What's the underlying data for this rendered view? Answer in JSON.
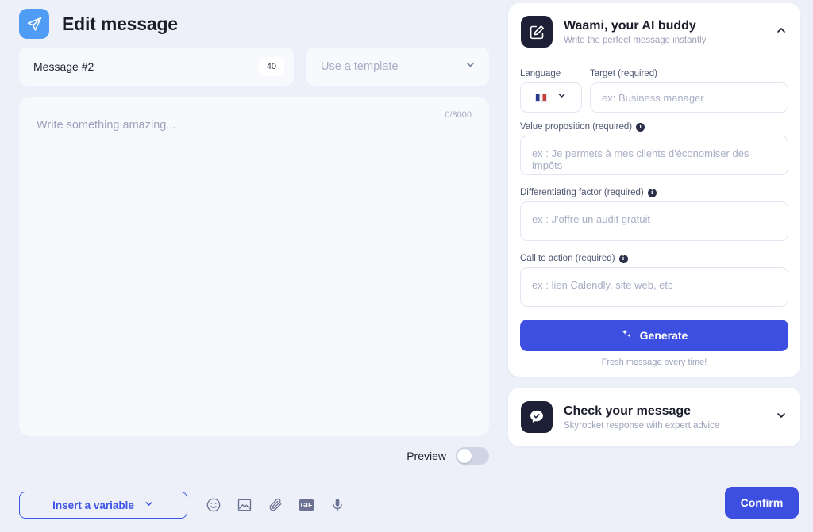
{
  "header": {
    "title": "Edit message",
    "logo_icon": "paper-plane-icon"
  },
  "message_bar": {
    "name": "Message #2",
    "char_badge": "40",
    "template_placeholder": "Use a template",
    "template_chevron": "chevron-down-icon"
  },
  "compose": {
    "placeholder": "Write something amazing...",
    "counter": "0/8000"
  },
  "preview": {
    "label": "Preview",
    "enabled": false
  },
  "toolbar": {
    "insert_variable_label": "Insert a variable",
    "icons": [
      {
        "name": "emoji-icon",
        "label": "emoji"
      },
      {
        "name": "image-icon",
        "label": "image"
      },
      {
        "name": "attachment-icon",
        "label": "attachment"
      },
      {
        "name": "gif-icon",
        "label": "GIF"
      },
      {
        "name": "microphone-icon",
        "label": "voice"
      }
    ],
    "gif_label": "GIF"
  },
  "sidebar": {
    "ai_card": {
      "title": "Waami, your AI buddy",
      "subtitle": "Write the perfect message instantly",
      "icon": "edit-square-icon",
      "chevron": "chevron-up-icon",
      "expanded": true,
      "fields": {
        "language_label": "Language",
        "language_value_flag": "flag-france-icon",
        "target_label": "Target (required)",
        "target_placeholder": "ex: Business manager",
        "value_prop_label": "Value proposition (required)",
        "value_prop_placeholder": "ex : Je permets à mes clients d'économiser des impôts",
        "diff_factor_label": "Differentiating factor (required)",
        "diff_factor_placeholder": "ex : J'offre un audit gratuit",
        "cta_label": "Call to action (required)",
        "cta_placeholder": "ex : lien Calendly, site web, etc",
        "info_char": "i"
      },
      "generate_label": "Generate",
      "generate_note": "Fresh message every time!"
    },
    "check_card": {
      "title": "Check your message",
      "subtitle": "Skyrocket response with expert advice",
      "icon": "chat-check-icon",
      "chevron": "chevron-down-icon",
      "expanded": false
    }
  },
  "footer": {
    "confirm_label": "Confirm"
  },
  "colors": {
    "page_bg": "#edf0f9",
    "accent_blue": "#3d4fe0",
    "logo_blue": "#4f9cf5",
    "dark_navy": "#1c1f35",
    "muted_text": "#9ca2bb"
  }
}
